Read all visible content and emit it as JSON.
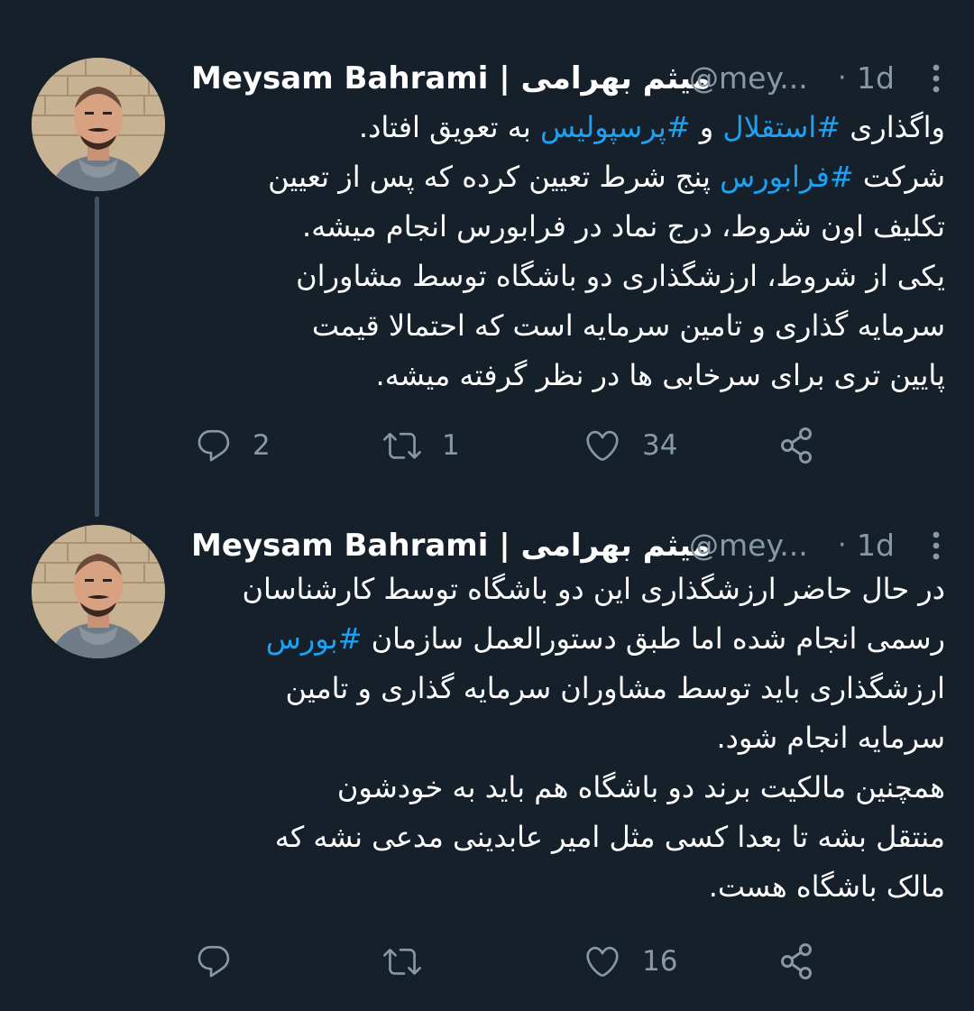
{
  "colors": {
    "background": "#15202b",
    "text_primary": "#ffffff",
    "text_secondary": "#8899a6",
    "hashtag": "#1da1f2",
    "thread_line": "#3d5466"
  },
  "tweets": [
    {
      "author_name": "Meysam Bahrami | میثم بهرامی",
      "handle": "@mey...",
      "separator": "·",
      "time": "1d",
      "more_icon": "more-vertical-icon",
      "lines": [
        [
          {
            "text": "واگذاری ",
            "hashtag": false
          },
          {
            "text": "#استقلال",
            "hashtag": true
          },
          {
            "text": " و ",
            "hashtag": false
          },
          {
            "text": "#پرسپولیس",
            "hashtag": true
          },
          {
            "text": " به تعویق افتاد.",
            "hashtag": false
          }
        ],
        [
          {
            "text": "شرکت ",
            "hashtag": false
          },
          {
            "text": "#فرابورس",
            "hashtag": true
          },
          {
            "text": " پنج شرط تعیین کرده که پس از تعیین",
            "hashtag": false
          }
        ],
        [
          {
            "text": "تکلیف اون شروط، درج نماد در فرابورس انجام میشه.",
            "hashtag": false
          }
        ],
        [
          {
            "text": "یکی از شروط، ارزشگذاری دو باشگاه توسط مشاوران",
            "hashtag": false
          }
        ],
        [
          {
            "text": "سرمایه گذاری و تامین سرمایه است که احتمالا قیمت",
            "hashtag": false
          }
        ],
        [
          {
            "text": "پایین تری برای سرخابی ها در نظر گرفته میشه.",
            "hashtag": false
          }
        ]
      ],
      "reply_count": "2",
      "retweet_count": "1",
      "like_count": "34"
    },
    {
      "author_name": "Meysam Bahrami | میثم بهرامی",
      "handle": "@mey...",
      "separator": "·",
      "time": "1d",
      "more_icon": "more-vertical-icon",
      "lines": [
        [
          {
            "text": "در حال حاضر ارزشگذاری این دو باشگاه توسط کارشناسان",
            "hashtag": false
          }
        ],
        [
          {
            "text": "رسمی انجام شده اما طبق دستورالعمل سازمان ",
            "hashtag": false
          },
          {
            "text": "#بورس",
            "hashtag": true
          }
        ],
        [
          {
            "text": "ارزشگذاری باید توسط مشاوران سرمایه گذاری و تامین",
            "hashtag": false
          }
        ],
        [
          {
            "text": "سرمایه انجام شود.",
            "hashtag": false
          }
        ],
        [
          {
            "text": "همچنین مالکیت برند دو باشگاه هم باید به خودشون",
            "hashtag": false
          }
        ],
        [
          {
            "text": "منتقل بشه تا بعدا کسی مثل امیر عابدینی مدعی نشه که",
            "hashtag": false
          }
        ],
        [
          {
            "text": "مالک باشگاه هست.",
            "hashtag": false
          }
        ]
      ],
      "reply_count": "",
      "retweet_count": "",
      "like_count": "16"
    }
  ],
  "icons": {
    "reply": "reply-icon",
    "retweet": "retweet-icon",
    "like": "like-icon",
    "share": "share-icon"
  }
}
